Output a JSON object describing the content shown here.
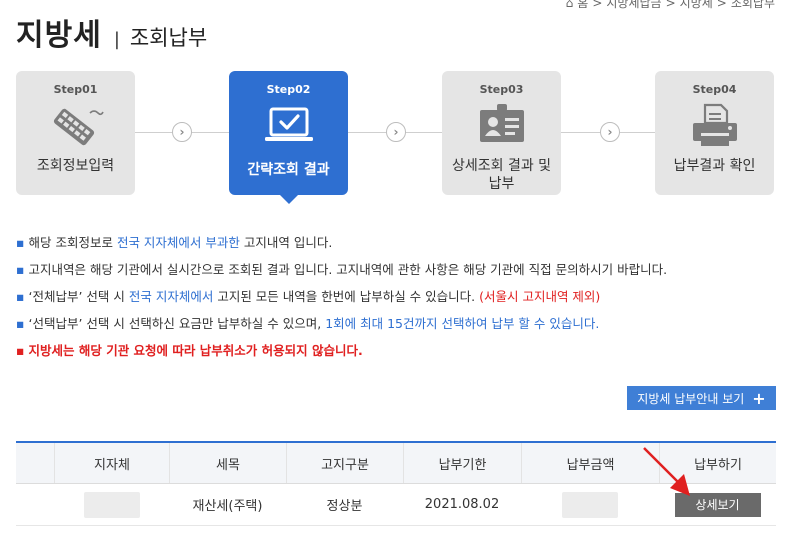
{
  "breadcrumb": {
    "home": "홈",
    "items": [
      "지방세납금",
      "지방세",
      "조회납부"
    ]
  },
  "page": {
    "title": "지방세",
    "separator": "|",
    "subtitle": "조회납부"
  },
  "steps": [
    {
      "num": "Step01",
      "label": "조회정보입력",
      "icon": "keyboard-icon",
      "active": false
    },
    {
      "num": "Step02",
      "label": "간략조회 결과",
      "icon": "laptop-check-icon",
      "active": true
    },
    {
      "num": "Step03",
      "label": "상세조회 결과 및 납부",
      "icon": "id-card-icon",
      "active": false
    },
    {
      "num": "Step04",
      "label": "납부결과 확인",
      "icon": "printer-icon",
      "active": false
    }
  ],
  "notes": {
    "n1": {
      "a": "해당 조회정보로 ",
      "b": "전국 지자체에서 부과한",
      "c": " 고지내역 입니다."
    },
    "n2": {
      "a": "고지내역은 해당 기관에서 실시간으로 조회된 결과 입니다. 고지내역에 관한 사항은 해당 기관에 직접 문의하시기 바랍니다."
    },
    "n3": {
      "a": "‘전체납부’ 선택 시 ",
      "b": "전국 지자체에서",
      "c": " 고지된 모든 내역을 한번에 납부하실 수 있습니다. ",
      "d": "(서울시 고지내역 제외)"
    },
    "n4": {
      "a": "‘선택납부’ 선택 시 선택하신 요금만 납부하실 수 있으며, ",
      "b": "1회에 최대 15건까지 선택하여 납부 할 수 있습니다."
    },
    "n5": {
      "a": "지방세는 해당 기관 요청에 따라 납부취소가 허용되지 않습니다."
    }
  },
  "guide_button": {
    "label": "지방세 납부안내 보기",
    "icon": "+"
  },
  "table": {
    "headers": [
      "",
      "지자체",
      "세목",
      "고지구분",
      "납부기한",
      "납부금액",
      "납부하기"
    ],
    "rows": [
      {
        "checkbox": "",
        "region": "",
        "tax_item": "재산세(주택)",
        "type": "정상분",
        "due_date": "2021.08.02",
        "amount": "",
        "action": "상세보기"
      }
    ]
  },
  "colors": {
    "primary": "#2e6fd1",
    "alert": "#e02020",
    "step_inactive": "#e5e5e5",
    "detail_button": "#6a6a6a"
  }
}
